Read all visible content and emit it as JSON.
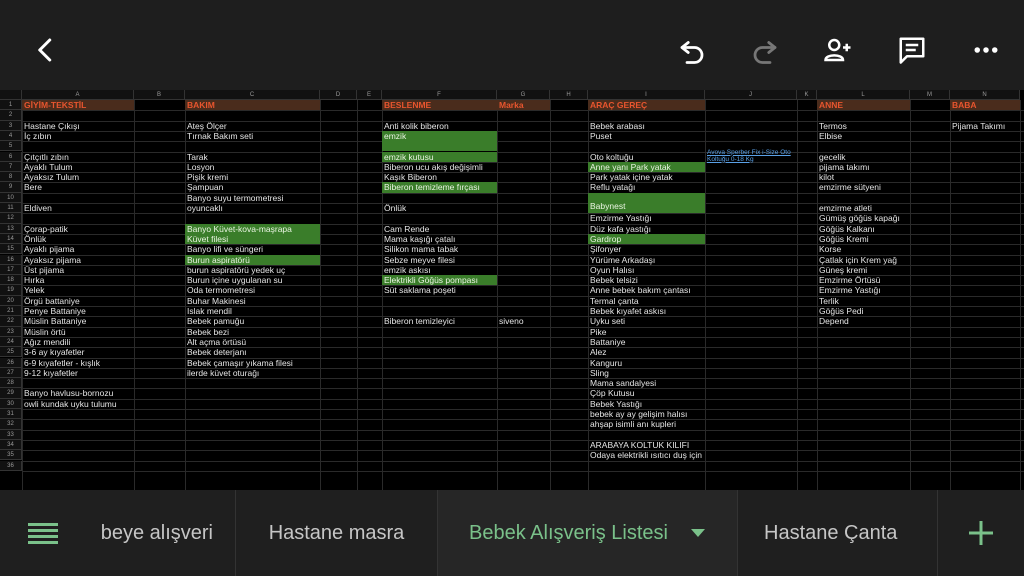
{
  "columns": [
    "A",
    "B",
    "C",
    "D",
    "E",
    "F",
    "G",
    "H",
    "I",
    "J",
    "K",
    "L",
    "M",
    "N"
  ],
  "rows": [
    "1",
    "2",
    "3",
    "4",
    "5",
    "6",
    "7",
    "8",
    "9",
    "10",
    "11",
    "12",
    "13",
    "14",
    "15",
    "16",
    "17",
    "18",
    "19",
    "20",
    "21",
    "22",
    "23",
    "24",
    "25",
    "26",
    "27",
    "28",
    "29",
    "30",
    "31",
    "32",
    "33",
    "34",
    "35",
    "36"
  ],
  "headers": {
    "a": "GİYİM-TEKSTİL",
    "c": "BAKIM",
    "f": "BESLENME",
    "g": "Marka",
    "i": "ARAÇ GEREÇ",
    "l": "ANNE",
    "n": "BABA"
  },
  "col_a": [
    "Hastane Çıkışı",
    "İç zıbın",
    "Çıtçıtlı zıbın",
    "Ayaklı Tulum",
    "Ayaksız Tulum",
    "Bere",
    "Eldiven",
    "Çorap-patik",
    "Önlük",
    "Ayaklı pijama",
    "Ayaksız pijama",
    "Üst pijama",
    "Hırka",
    "Yelek",
    "Örgü battaniye",
    "Penye Battaniye",
    "Müslin Battaniye",
    "Müslin örtü",
    "Ağız mendili",
    "3-6 ay kıyafetler",
    "6-9 kıyafetler - kışlık",
    "9-12 kıyafetler",
    "Banyo havlusu-bornozu",
    "owli kundak uyku tulumu"
  ],
  "col_c": [
    "Ateş Ölçer",
    "Tırnak Bakım seti",
    "Tarak",
    "Losyon",
    "Pişik kremi",
    "Şampuan",
    "Banyo suyu termometresi",
    "oyuncaklı",
    "Banyo Küvet-kova-maşrapa",
    "Küvet filesi",
    "Banyo lifi ve süngeri",
    "Burun aspiratörü",
    "burun aspiratörü yedek uç",
    "Burun içine uygulanan su",
    "Oda termometresi",
    "Buhar Makinesi",
    "Islak mendil",
    "Bebek pamuğu",
    "Bebek bezi",
    "Alt açma örtüsü",
    "Bebek deterjanı",
    "Bebek çamaşır yıkama filesi",
    "ilerde küvet oturağı"
  ],
  "col_f": [
    "Anti kolik biberon",
    "emzik",
    "emzik kutusu",
    "Biberon ucu akış değişimli",
    "Kaşık Biberon",
    "Biberon temizleme fırçası",
    "Önlük",
    "Cam Rende",
    "Mama kaşığı çatalı",
    "Silikon mama tabak",
    "Sebze meyve filesi",
    "emzik askısı",
    "Elektrikli Göğüs pompası",
    "Süt saklama poşeti",
    "Biberon temizleyici"
  ],
  "col_g": [
    "siveno"
  ],
  "col_i": [
    "Bebek arabası",
    "Puset",
    "Oto koltuğu",
    "Anne yanı Park yatak",
    "Park yatak içine yatak",
    "Reflu yatağı",
    "Babynest",
    "Emzirme Yastığı",
    "Düz kafa yastığı",
    "Gardrop",
    "Şifonyer",
    "Yürüme Arkadaşı",
    "Oyun Halısı",
    "Bebek telsizi",
    "Anne bebek bakım çantası",
    "Termal çanta",
    "Bebek kıyafet askısı",
    "Uyku seti",
    "Pike",
    "Battaniye",
    "Alez",
    "Kanguru",
    "Sling",
    "Mama sandalyesi",
    "Çöp Kutusu",
    "Bebek Yastığı",
    "bebek ay ay gelişim halısı",
    "ahşap isimli anı kupleri",
    "ARABAYA KOLTUK KILIFI",
    "Odaya elektrikli ısıtıcı duş için"
  ],
  "col_j": [
    "Avova Sperber Fix i-Size Oto Koltuğu 0-18 Kg"
  ],
  "col_l": [
    "Termos",
    "Elbise",
    "gecelik",
    "pijama takımı",
    "kilot",
    "emzirme sütyeni",
    "emzirme atleti",
    "Gümüş göğüs kapağı",
    "Göğüs Kalkanı",
    "Göğüs Kremi",
    "Korse",
    "Çatlak için Krem yağ",
    "Güneş kremi",
    "Emzirme Örtüsü",
    "Emzirme Yastığı",
    "Terlik",
    "Göğüs Pedi",
    "Depend"
  ],
  "col_n": [
    "Pijama Takımı"
  ],
  "tabs": [
    "beye alışveri",
    "Hastane masra",
    "Bebek Alışveriş Listesi",
    "Hastane Çanta"
  ],
  "active_tab_index": 2,
  "icons": {
    "back": "back-arrow-icon",
    "undo": "undo-icon",
    "redo": "redo-icon",
    "share": "add-person-icon",
    "comment": "comment-icon",
    "more": "more-icon",
    "menu": "sheet-list-icon",
    "add": "plus-icon",
    "dropdown": "dropdown-arrow-icon"
  },
  "colors": {
    "accent_green": "#7ac18a",
    "highlight_green": "#3a7d2a",
    "header_orange": "#e8552e"
  }
}
